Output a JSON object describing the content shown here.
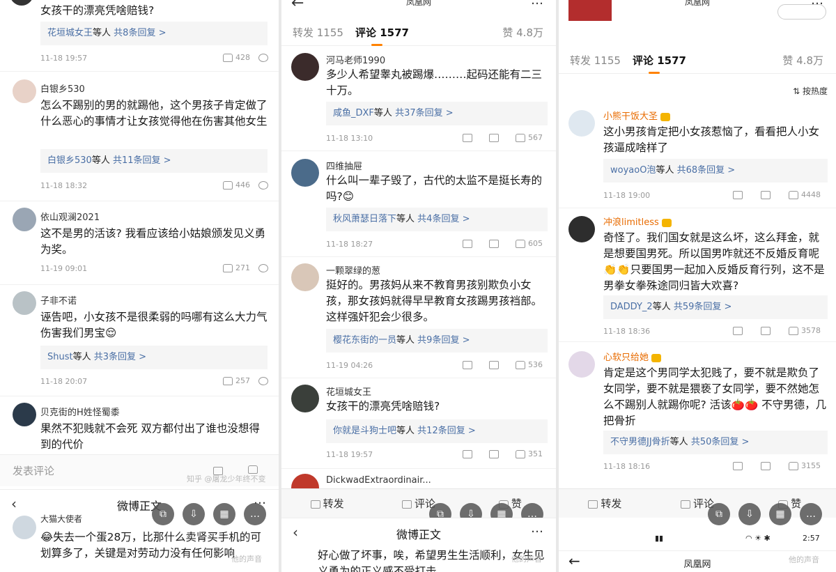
{
  "colors": {
    "accent": "#ff8200",
    "link": "#4a6fa5",
    "meta": "#999999",
    "vip": "#e86b00"
  },
  "p1": {
    "top_comment_text": "女孩干的漂亮凭啥赔钱?",
    "top_reply": {
      "name": "花垣城女王",
      "suffix": "等人",
      "count": "共8条回复 >"
    },
    "top_time": "11-18 19:57",
    "top_likes": "428",
    "comments": [
      {
        "user": "白银乡530",
        "text": "怎么不踢别的男的就踢他，这个男孩子肯定做了什么恶心的事情才让女孩觉得他在伤害其他女生",
        "reply_name": "白银乡530",
        "reply_suffix": "等人",
        "reply_count": "共11条回复 >",
        "time": "11-18 18:32",
        "likes": "446"
      },
      {
        "user": "依山观澜2021",
        "text": "这不是男的活该? 我看应该给小姑娘颁发见义勇为奖。",
        "time": "11-19 09:01",
        "likes": "271"
      },
      {
        "user": "子非不诺",
        "text": "诬告吧，小女孩不是很柔弱的吗哪有这么大力气伤害我们男宝😌",
        "reply_name": "Shust",
        "reply_suffix": "等人",
        "reply_count": "共3条回复 >",
        "time": "11-18 20:07",
        "likes": "257"
      },
      {
        "user": "贝克街的H姓怪蜀黍",
        "text": "果然不犯贱就不会死 双方都付出了谁也没想得到的代价"
      }
    ],
    "input_placeholder": "发表评论",
    "watermark": "知乎 @屠龙少年终不变",
    "subhead_title": "微博正文",
    "bottom_user": "大猫大使者",
    "bottom_text": "😂失去一个蛋28万，比那什么卖肾买手机的可划算多了，关键是对劳动力没有任何影响",
    "bottom_watermark": "他的声音"
  },
  "p2": {
    "site": "凤凰网",
    "tab_repost": "转发 1155",
    "tab_comment": "评论 1577",
    "tab_like": "赞 4.8万",
    "comments": [
      {
        "user": "河马老师1990",
        "text": "多少人希望睾丸被踢爆………起码还能有二三十万。",
        "reply_name": "咸鱼_DXF",
        "reply_suffix": "等人",
        "reply_count": "共37条回复 >",
        "time": "11-18 13:10",
        "likes": "567"
      },
      {
        "user": "四维抽屉",
        "text": "什么叫一辈子毁了，古代的太监不是挺长寿的吗?😊",
        "reply_name": "秋风萧瑟日落下",
        "reply_suffix": "等人",
        "reply_count": "共4条回复 >",
        "time": "11-18 18:27",
        "likes": "605"
      },
      {
        "user": "一颗翠绿的葱",
        "text": "挺好的。男孩妈从来不教育男孩别欺负小女孩，那女孩妈就得早早教育女孩踢男孩裆部。这样强奸犯会少很多。",
        "reply_name": "樱花东街的一员",
        "reply_suffix": "等人",
        "reply_count": "共9条回复 >",
        "time": "11-19 04:26",
        "likes": "536"
      },
      {
        "user": "花垣城女王",
        "text": "女孩干的漂亮凭啥赔钱?",
        "reply_name": "你就是斗狗士吧",
        "reply_suffix": "等人",
        "reply_count": "共12条回复 >",
        "time": "11-18 19:57",
        "likes": "351"
      },
      {
        "user": "DickwadExtraordinair..."
      }
    ],
    "action_repost": "转发",
    "action_comment": "评论",
    "action_like": "赞",
    "subhead_title": "微博正文",
    "bottom_text": "好心做了坏事，唉，希望男生生活顺利，女生见义勇为的正义感不受打击",
    "bottom_watermark": "他的声音"
  },
  "p3": {
    "site": "凤凰网",
    "tab_repost": "转发 1155",
    "tab_comment": "评论 1577",
    "tab_like": "赞 4.8万",
    "sort_label": "按热度",
    "comments": [
      {
        "user": "小熊干饭大圣",
        "text": "这小男孩肯定把小女孩惹恼了，看看把人小女孩逼成啥样了",
        "reply_name": "woyaoO泡",
        "reply_suffix": "等人",
        "reply_count": "共68条回复 >",
        "time": "11-18 19:00",
        "likes": "4448"
      },
      {
        "user": "冲浪limitless",
        "text": "奇怪了。我们国女就是这么坏，这么拜金，就是想要国男死。所以国男咋就还不反婚反育呢👏👏只要国男一起加入反婚反育行列，这不是男拳女拳殊途同归皆大欢喜?",
        "reply_name": "DADDY_2",
        "reply_suffix": "等人",
        "reply_count": "共59条回复 >",
        "time": "11-18 18:36",
        "likes": "3578"
      },
      {
        "user": "心软只给她",
        "text": "肯定是这个男同学太犯贱了，要不就是欺负了女同学，要不就是猥亵了女同学，要不然她怎么不踢别人就踢你呢? 活该🍅🍅 不守男德，几把骨折",
        "reply_name": "不守男德JJ骨折",
        "reply_suffix": "等人",
        "reply_count": "共50条回复 >",
        "time": "11-18 18:16",
        "likes": "3155"
      }
    ],
    "action_repost": "转发",
    "action_comment": "评论",
    "action_like": "赞",
    "status_time": "2:57",
    "bottom_site": "凤凰网",
    "bottom_watermark": "他的声音"
  }
}
